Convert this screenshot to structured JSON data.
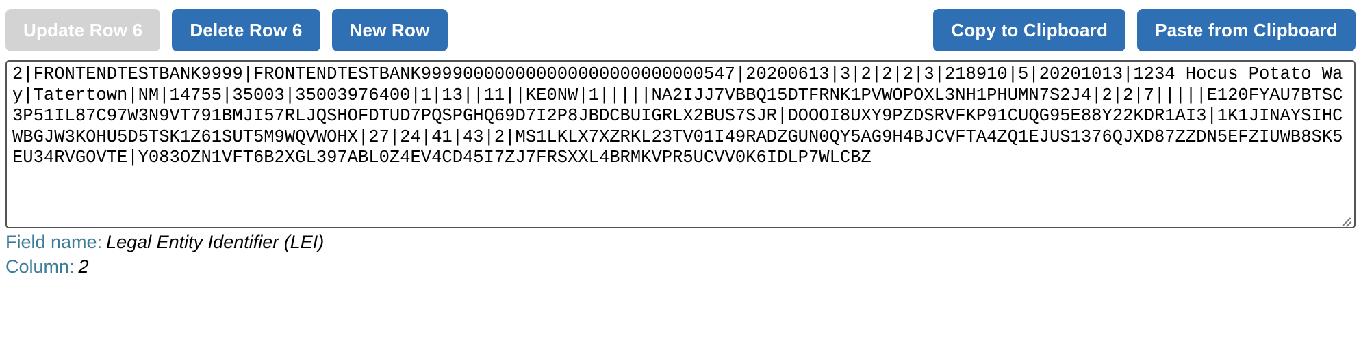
{
  "toolbar": {
    "left_buttons": [
      {
        "label": "Update Row 6",
        "state": "disabled",
        "name": "update-row-button"
      },
      {
        "label": "Delete Row 6",
        "state": "enabled",
        "name": "delete-row-button"
      },
      {
        "label": "New Row",
        "state": "enabled",
        "name": "new-row-button"
      }
    ],
    "right_buttons": [
      {
        "label": "Copy to Clipboard",
        "state": "enabled",
        "name": "copy-to-clipboard-button"
      },
      {
        "label": "Paste from Clipboard",
        "state": "enabled",
        "name": "paste-from-clipboard-button"
      }
    ]
  },
  "editor": {
    "content": "2|FRONTENDTESTBANK9999|FRONTENDTESTBANK999900000000000000000000000547|20200613|3|2|2|2|3|218910|5|20201013|1234 Hocus Potato Way|Tatertown|NM|14755|35003|35003976400|1|13||11||KE0NW|1|||||NA2IJJ7VBBQ15DTFRNK1PVWOPOXL3NH1PHUMN7S2J4|2|2|7|||||E120FYAU7BTSC3P51IL87C97W3N9VT791BMJI57RLJQSHOFDTUD7PQSPGHQ69D7I2P8JBDCBUIGRLX2BUS7SJR|DOOOI8UXY9PZDSRVFKP91CUQG95E88Y22KDR1AI3|1K1JINAYSIHCWBGJW3KOHU5D5TSK1Z61SUT5M9WQVWOHX|27|24|41|43|2|MS1LKLX7XZRKL23TV01I49RADZGUN0QY5AG9H4BJCVFTA4ZQ1EJUS1376QJXD87ZZDN5EFZIUWB8SK5EU34RVGOVTE|Y083OZN1VFT6B2XGL397ABL0Z4EV4CD45I7ZJ7FRSXXL4BRMKVPR5UCVV0K6IDLP7WLCBZ",
    "resize_handle": "resize-grip-icon"
  },
  "info": {
    "field_name_label": "Field name:",
    "field_name_value": "Legal Entity Identifier (LEI)",
    "column_label": "Column:",
    "column_value": "2"
  },
  "colors": {
    "primary_button": "#2f6fb4",
    "disabled_button": "#d3d3d3",
    "info_label": "#3c7c96",
    "border": "#545454"
  }
}
